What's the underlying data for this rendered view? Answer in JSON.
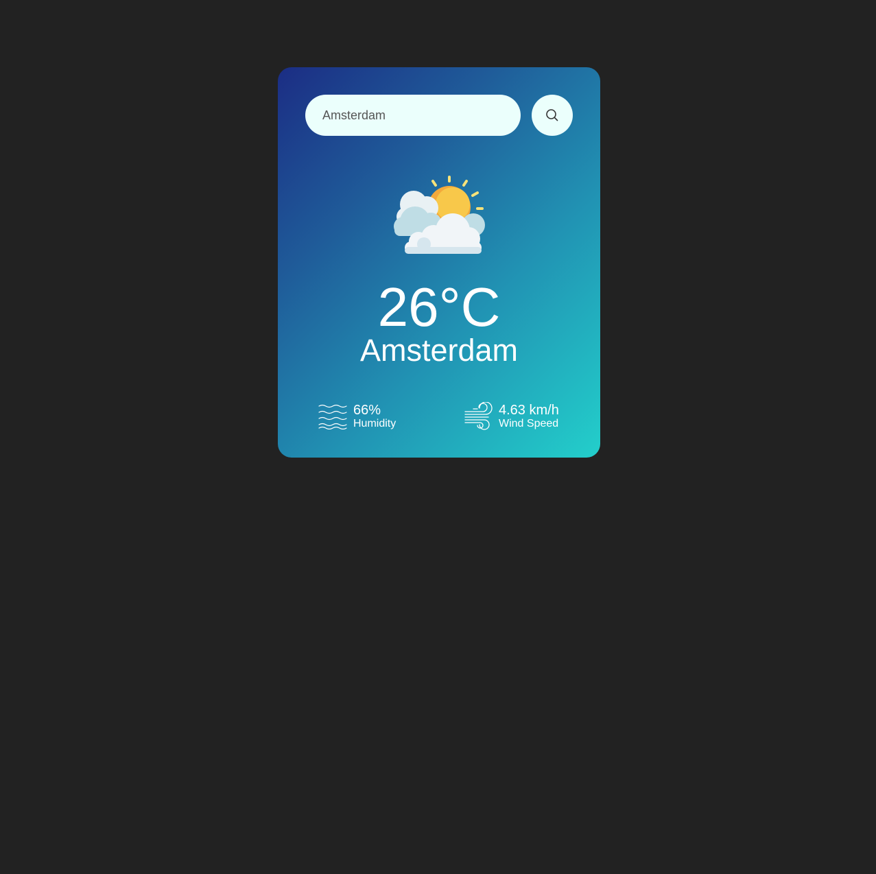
{
  "search": {
    "value": "Amsterdam",
    "icon": "search-icon"
  },
  "weather": {
    "icon": "partly-cloudy-icon",
    "temperature": "26°C",
    "city": "Amsterdam"
  },
  "details": {
    "humidity": {
      "icon": "humidity-waves-icon",
      "value": "66%",
      "label": "Humidity"
    },
    "wind": {
      "icon": "wind-icon",
      "value": "4.63 km/h",
      "label": "Wind Speed"
    }
  },
  "colors": {
    "page_background": "#222222",
    "card_gradient_start": "#1b2d84",
    "card_gradient_end": "#23cfcb",
    "input_background": "#ebfffc",
    "text": "#ffffff"
  }
}
